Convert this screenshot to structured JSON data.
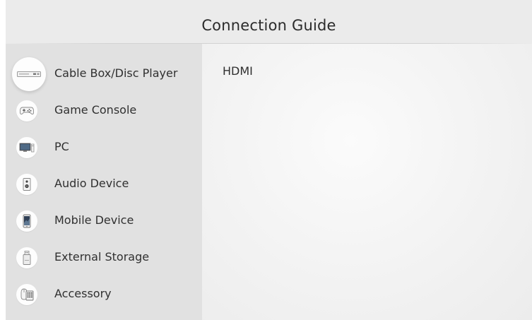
{
  "header": {
    "title": "Connection Guide"
  },
  "sidebar": {
    "items": [
      {
        "label": "Cable Box/Disc Player",
        "icon": "cable-box-icon",
        "selected": true
      },
      {
        "label": "Game Console",
        "icon": "gamepad-icon",
        "selected": false
      },
      {
        "label": "PC",
        "icon": "pc-monitor-icon",
        "selected": false
      },
      {
        "label": "Audio Device",
        "icon": "speaker-icon",
        "selected": false
      },
      {
        "label": "Mobile Device",
        "icon": "mobile-phone-icon",
        "selected": false
      },
      {
        "label": "External Storage",
        "icon": "usb-drive-icon",
        "selected": false
      },
      {
        "label": "Accessory",
        "icon": "keyboard-mouse-icon",
        "selected": false
      }
    ]
  },
  "main": {
    "connection_type": "HDMI"
  },
  "colors": {
    "sidebar_bg": "#e1e1e1",
    "content_bg": "#f6f6f6",
    "header_bg": "#ebebeb",
    "text": "#303030"
  }
}
